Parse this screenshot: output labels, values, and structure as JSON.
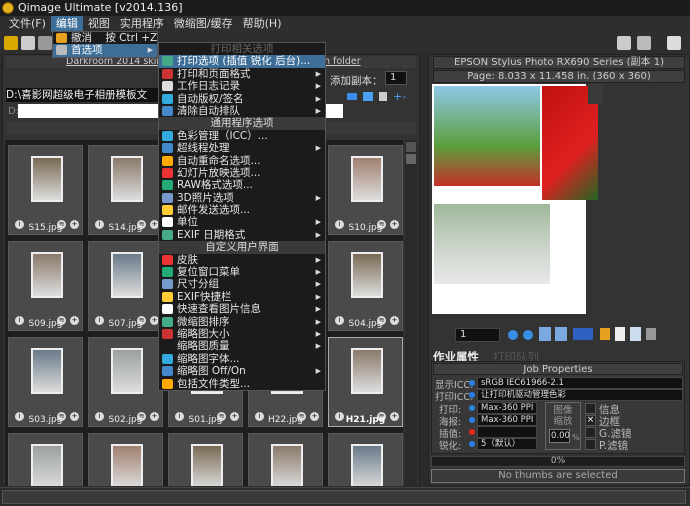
{
  "window": {
    "title": "Qimage Ultimate [v2014.136]"
  },
  "menubar": [
    "文件(F)",
    "编辑",
    "视图",
    "实用程序",
    "微缩图/缓存",
    "帮助(H)"
  ],
  "edit_menu": {
    "items": [
      {
        "label": "撤消",
        "shortcut": "按 Ctrl +Z"
      },
      {
        "label": "首选项"
      }
    ]
  },
  "prefs_menu": {
    "sections": [
      {
        "header": "打印相关选项",
        "items": [
          {
            "label": "打印选项 (插值 锐化 后台)...",
            "sub": false,
            "icon": "print-options-icon",
            "highlight": true
          },
          {
            "label": "打印和页面格式",
            "sub": true,
            "icon": "page-format-icon"
          },
          {
            "label": "工作日志记录",
            "sub": true,
            "icon": "job-log-icon"
          },
          {
            "label": "自动版权/签名",
            "sub": true,
            "icon": "copyright-icon"
          },
          {
            "label": "清除自动排队",
            "sub": true,
            "icon": "eraser-icon"
          }
        ]
      },
      {
        "header": "通用程序选项",
        "items": [
          {
            "label": "色彩管理（ICC）...",
            "sub": false,
            "icon": "color-management-icon"
          },
          {
            "label": "超线程处理",
            "sub": true,
            "icon": "clock-icon"
          },
          {
            "label": "自动重命名选项...",
            "sub": false,
            "icon": "rename-icon"
          },
          {
            "label": "幻灯片放映选项...",
            "sub": false,
            "icon": "slideshow-icon"
          },
          {
            "label": "RAW格式选项...",
            "sub": false,
            "icon": "raw-icon"
          },
          {
            "label": "3D照片选项",
            "sub": true,
            "icon": "3d-icon"
          },
          {
            "label": "邮件发送选项...",
            "sub": false,
            "icon": "mail-icon"
          },
          {
            "label": "单位",
            "sub": true,
            "icon": "units-icon"
          },
          {
            "label": "EXIF 日期格式",
            "sub": true,
            "icon": "info-icon"
          }
        ]
      },
      {
        "header": "自定义用户界面",
        "items": [
          {
            "label": "皮肤",
            "sub": true,
            "icon": "skin-icon"
          },
          {
            "label": "复位窗口菜单",
            "sub": true,
            "icon": "window-reset-icon"
          },
          {
            "label": "尺寸分组",
            "sub": true,
            "icon": "size-group-icon"
          },
          {
            "label": "EXIF快捷栏",
            "sub": true,
            "icon": "info-icon"
          },
          {
            "label": "快速查看图片信息",
            "sub": true,
            "icon": "magnifier-icon"
          },
          {
            "label": "微缩图排序",
            "sub": true,
            "icon": "sort-icon"
          },
          {
            "label": "缩略图大小",
            "sub": true,
            "icon": "thumb-size-icon"
          },
          {
            "label": "缩略图质量",
            "sub": true,
            "icon": ""
          },
          {
            "label": "缩略图字体...",
            "sub": false,
            "icon": "font-icon"
          },
          {
            "label": "缩略图 Off/On",
            "sub": true,
            "icon": "tools-icon"
          },
          {
            "label": "包括文件类型...",
            "sub": false,
            "icon": "checkmark-icon"
          }
        ]
      }
    ]
  },
  "left_panel": {
    "skin_link": "Darkroom 2014 skin",
    "folder_link": "n folder",
    "copies_label": "添加副本：",
    "copies_value": "1",
    "path": "D:\\喜影网超级电子相册模板文",
    "path2": "D:",
    "thumbnails": [
      [
        "S15.jpg",
        "S14.jpg",
        "",
        "",
        "S10.jpg"
      ],
      [
        "S09.jpg",
        "S07.jpg",
        "",
        "",
        "S04.jpg"
      ],
      [
        "S03.jpg",
        "S02.jpg",
        "S01.jpg",
        "H22.jpg",
        "H21.jpg"
      ]
    ],
    "selected": "H21.jpg"
  },
  "right_panel": {
    "printer": "EPSON Stylus Photo RX690 Series (副本 1)",
    "page": "Page: 8.033 x 11.458 in.  (360 x 360)",
    "page_number": "1",
    "tabs": [
      "作业属性",
      "打印队列"
    ],
    "job": {
      "title": "Job Properties",
      "display_icc_label": "显示ICC:",
      "display_icc": "sRGB IEC61966-2.1",
      "print_icc_label": "打印ICC:",
      "print_icc": "让打印机驱动管理色彩",
      "print_label": "打印:",
      "print_value": "Max-360 PPI",
      "poster_label": "海报:",
      "poster_value": "Max-360 PPI",
      "interp_label": "插值:",
      "interp_value": "",
      "sharpen_label": "锐化:",
      "sharpen_value": "5（默认）",
      "scale_label": "图像缩放",
      "scale_value": "0.00",
      "scale_unit": "%",
      "checks": [
        {
          "label": "信息",
          "checked": false
        },
        {
          "label": "边框",
          "checked": true
        },
        {
          "label": "G.滤镜",
          "checked": false
        },
        {
          "label": "P.滤镜",
          "checked": false
        }
      ]
    },
    "progress": "0%",
    "progress_value": 0,
    "status": "No thumbs are selected"
  }
}
